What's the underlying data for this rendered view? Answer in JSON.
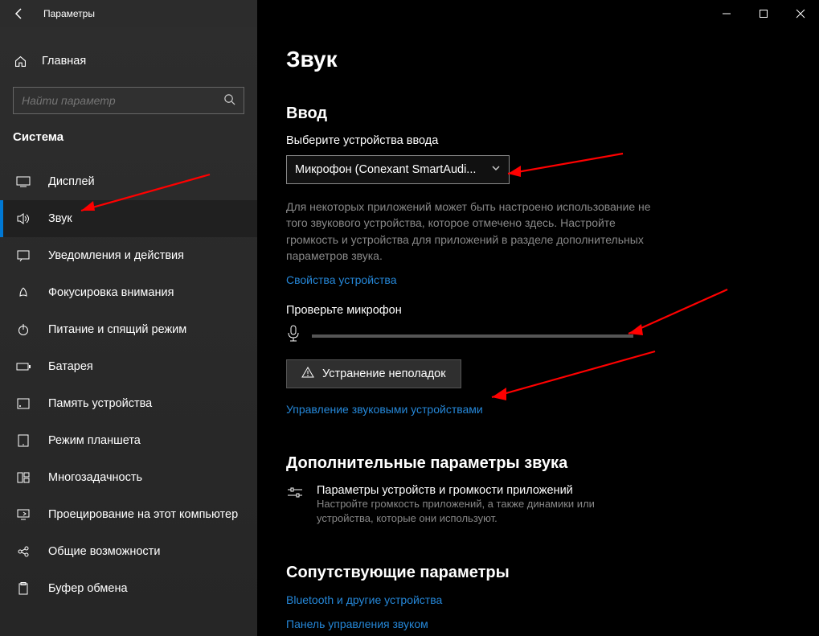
{
  "window": {
    "title": "Параметры"
  },
  "sidebar": {
    "home": "Главная",
    "search_placeholder": "Найти параметр",
    "group": "Система",
    "items": [
      {
        "label": "Дисплей"
      },
      {
        "label": "Звук"
      },
      {
        "label": "Уведомления и действия"
      },
      {
        "label": "Фокусировка внимания"
      },
      {
        "label": "Питание и спящий режим"
      },
      {
        "label": "Батарея"
      },
      {
        "label": "Память устройства"
      },
      {
        "label": "Режим планшета"
      },
      {
        "label": "Многозадачность"
      },
      {
        "label": "Проецирование на этот компьютер"
      },
      {
        "label": "Общие возможности"
      },
      {
        "label": "Буфер обмена"
      }
    ]
  },
  "content": {
    "page_title": "Звук",
    "input": {
      "title": "Ввод",
      "choose_label": "Выберите устройства ввода",
      "dropdown_value": "Микрофон (Conexant SmartAudi...",
      "desc": "Для некоторых приложений может быть настроено использование не того звукового устройства, которое отмечено здесь. Настройте громкость и устройства для приложений в разделе дополнительных параметров звука.",
      "device_props_link": "Свойства устройства",
      "test_label": "Проверьте микрофон",
      "troubleshoot_btn": "Устранение неполадок",
      "manage_link": "Управление звуковыми устройствами"
    },
    "advanced": {
      "title": "Дополнительные параметры звука",
      "row_title": "Параметры устройств и громкости приложений",
      "row_desc": "Настройте громкость приложений, а также динамики или устройства, которые они используют."
    },
    "related": {
      "title": "Сопутствующие параметры",
      "links": [
        "Bluetooth и другие устройства",
        "Панель управления звуком"
      ]
    }
  }
}
